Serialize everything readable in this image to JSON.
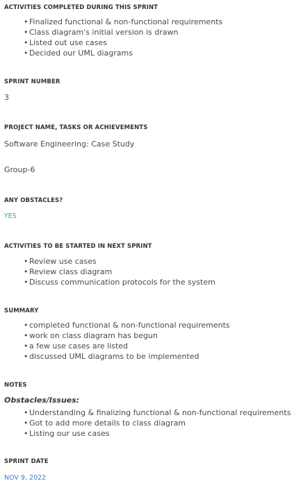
{
  "sections": {
    "activities_completed": {
      "label": "ACTIVITIES COMPLETED DURING THIS SPRINT",
      "items": [
        "Finalized functional & non-functional requirements",
        "Class diagram's initial version is drawn",
        "Listed out use cases",
        "Decided our UML diagrams"
      ]
    },
    "sprint_number": {
      "label": "SPRINT NUMBER",
      "value": "3"
    },
    "project": {
      "label": "PROJECT NAME, TASKS OR ACHIEVEMENTS",
      "line1": "Software Engineering: Case Study",
      "line2": "Group-6"
    },
    "obstacles": {
      "label": "ANY OBSTACLES?",
      "value": "YES",
      "color": "#25b07a"
    },
    "next_sprint": {
      "label": "ACTIVITIES TO BE STARTED IN NEXT SPRINT",
      "items": [
        "Review use cases",
        "Review class diagram",
        "Discuss communication protocols for the system"
      ]
    },
    "summary": {
      "label": "SUMMARY",
      "items": [
        "completed functional & non-functional requirements",
        "work on class diagram has begun",
        "a few use cases are listed",
        "discussed UML diagrams to be implemented"
      ]
    },
    "notes": {
      "label": "NOTES",
      "heading": "Obstacles/Issues:",
      "items": [
        "Understanding & finalizing functional & non-functional requirements",
        "Got to add more details to class diagram",
        "Listing our use cases"
      ]
    },
    "sprint_date": {
      "label": "SPRINT DATE",
      "value": "NOV 9, 2022",
      "color": "#3d7bd9"
    }
  }
}
